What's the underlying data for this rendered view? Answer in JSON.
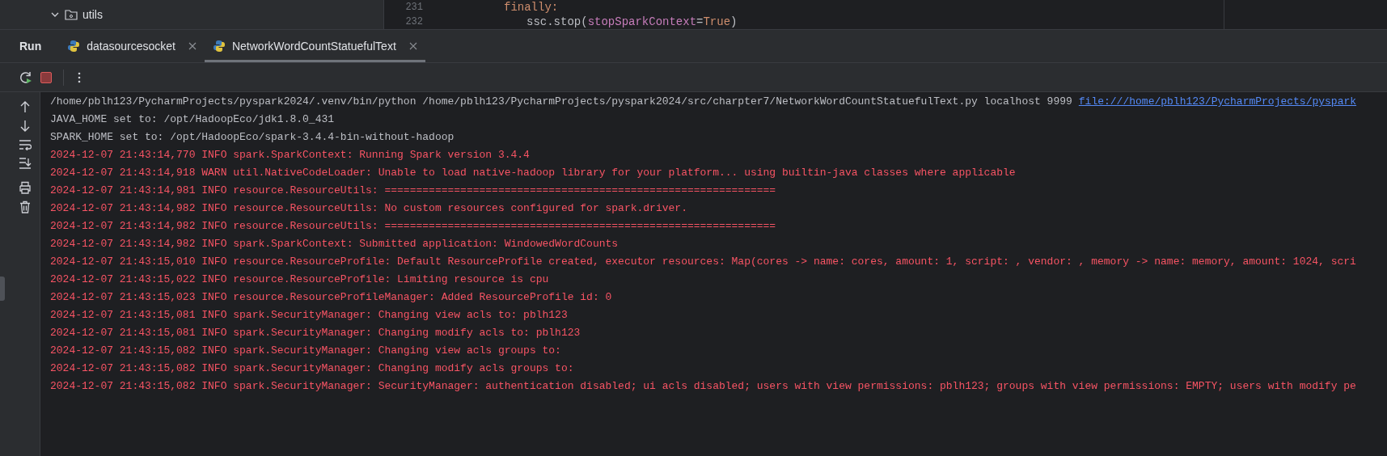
{
  "project_tree": {
    "items": [
      {
        "label": "utils",
        "expanded": true
      }
    ]
  },
  "editor": {
    "lines": [
      {
        "number": "231",
        "code": [
          {
            "kind": "keyword",
            "text": "finally:"
          }
        ]
      },
      {
        "number": "232",
        "code": [
          {
            "kind": "plain",
            "text": "ssc.stop("
          },
          {
            "kind": "param",
            "text": "stopSparkContext"
          },
          {
            "kind": "plain",
            "text": "="
          },
          {
            "kind": "keyword",
            "text": "True"
          },
          {
            "kind": "plain",
            "text": ")"
          }
        ]
      }
    ]
  },
  "run_panel": {
    "title": "Run",
    "tabs": [
      {
        "label": "datasourcesocket",
        "selected": false
      },
      {
        "label": "NetworkWordCountStatuefulText",
        "selected": true
      }
    ]
  },
  "console": {
    "lines": [
      {
        "kind": "stdout",
        "text": "/home/pblh123/PycharmProjects/pyspark2024/.venv/bin/python /home/pblh123/PycharmProjects/pyspark2024/src/charpter7/NetworkWordCountStatuefulText.py localhost 9999",
        "link": "file:///home/pblh123/PycharmProjects/pyspark"
      },
      {
        "kind": "stdout",
        "text": "JAVA_HOME set to: /opt/HadoopEco/jdk1.8.0_431"
      },
      {
        "kind": "stdout",
        "text": "SPARK_HOME set to: /opt/HadoopEco/spark-3.4.4-bin-without-hadoop"
      },
      {
        "kind": "stderr",
        "text": "2024-12-07 21:43:14,770 INFO spark.SparkContext: Running Spark version 3.4.4"
      },
      {
        "kind": "stderr",
        "text": "2024-12-07 21:43:14,918 WARN util.NativeCodeLoader: Unable to load native-hadoop library for your platform... using builtin-java classes where applicable"
      },
      {
        "kind": "stderr",
        "text": "2024-12-07 21:43:14,981 INFO resource.ResourceUtils: =============================================================="
      },
      {
        "kind": "stderr",
        "text": "2024-12-07 21:43:14,982 INFO resource.ResourceUtils: No custom resources configured for spark.driver."
      },
      {
        "kind": "stderr",
        "text": "2024-12-07 21:43:14,982 INFO resource.ResourceUtils: =============================================================="
      },
      {
        "kind": "stderr",
        "text": "2024-12-07 21:43:14,982 INFO spark.SparkContext: Submitted application: WindowedWordCounts"
      },
      {
        "kind": "stderr",
        "text": "2024-12-07 21:43:15,010 INFO resource.ResourceProfile: Default ResourceProfile created, executor resources: Map(cores -> name: cores, amount: 1, script: , vendor: , memory -> name: memory, amount: 1024, scri"
      },
      {
        "kind": "stderr",
        "text": "2024-12-07 21:43:15,022 INFO resource.ResourceProfile: Limiting resource is cpu"
      },
      {
        "kind": "stderr",
        "text": "2024-12-07 21:43:15,023 INFO resource.ResourceProfileManager: Added ResourceProfile id: 0"
      },
      {
        "kind": "stderr",
        "text": "2024-12-07 21:43:15,081 INFO spark.SecurityManager: Changing view acls to: pblh123"
      },
      {
        "kind": "stderr",
        "text": "2024-12-07 21:43:15,081 INFO spark.SecurityManager: Changing modify acls to: pblh123"
      },
      {
        "kind": "stderr",
        "text": "2024-12-07 21:43:15,082 INFO spark.SecurityManager: Changing view acls groups to:"
      },
      {
        "kind": "stderr",
        "text": "2024-12-07 21:43:15,082 INFO spark.SecurityManager: Changing modify acls groups to:"
      },
      {
        "kind": "stderr",
        "text": "2024-12-07 21:43:15,082 INFO spark.SecurityManager: SecurityManager: authentication disabled; ui acls disabled; users with view permissions: pblh123; groups with view permissions: EMPTY; users with modify pe"
      }
    ]
  }
}
